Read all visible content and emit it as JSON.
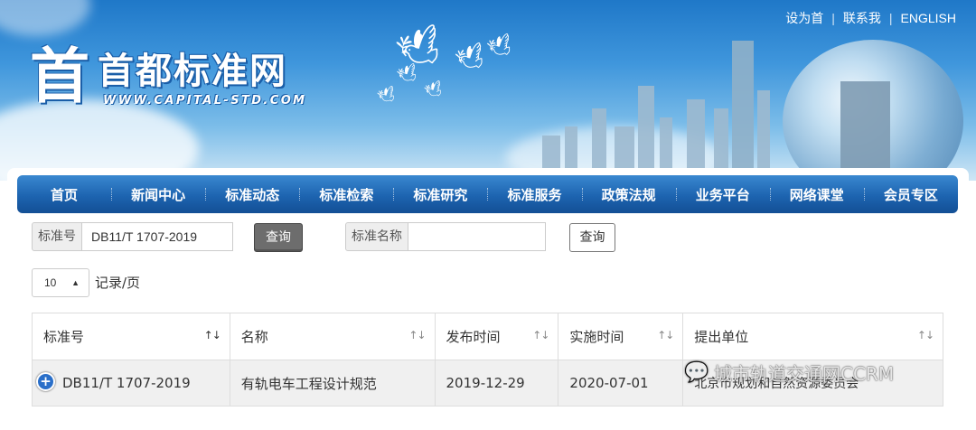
{
  "header": {
    "site_title": "首都标准网",
    "site_url": "WWW.CAPITAL-STD.COM",
    "logo_glyph": "首",
    "top_links": [
      "设为首",
      "联系我",
      "ENGLISH"
    ]
  },
  "nav": {
    "items": [
      "首页",
      "新闻中心",
      "标准动态",
      "标准检索",
      "标准研究",
      "标准服务",
      "政策法规",
      "业务平台",
      "网络课堂",
      "会员专区"
    ]
  },
  "search": {
    "std_no_label": "标准号",
    "std_no_value": "DB11/T 1707-2019",
    "query_button_1": "查询",
    "std_name_label": "标准名称",
    "std_name_value": "",
    "query_button_2": "查询"
  },
  "pagination": {
    "page_size": "10",
    "per_page_label": "记录/页"
  },
  "table": {
    "headers": [
      "标准号",
      "名称",
      "发布时间",
      "实施时间",
      "提出单位"
    ],
    "rows": [
      {
        "std_no": "DB11/T 1707-2019",
        "name": "有轨电车工程设计规范",
        "publish_date": "2019-12-29",
        "effective_date": "2020-07-01",
        "proposer": "北京市规划和自然资源委员会"
      }
    ]
  },
  "watermark": "城市轨道交通网CCRM",
  "colors": {
    "nav_blue": "#1d64b0",
    "expand_blue": "#2a6fc9",
    "row_bg": "#f0f0f0"
  }
}
